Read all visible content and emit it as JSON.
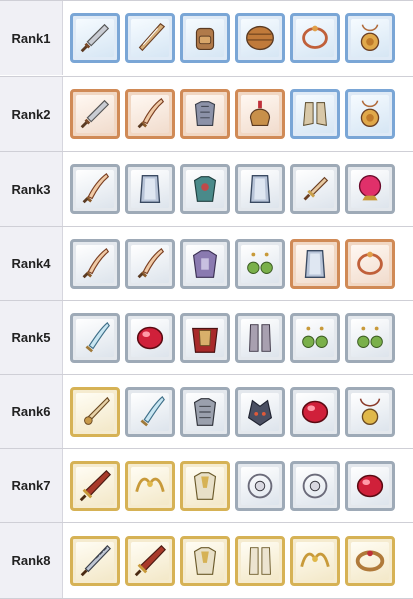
{
  "rows": [
    {
      "label": "Rank1",
      "items": [
        {
          "icon": "sword-icon",
          "frame": "blue"
        },
        {
          "icon": "blade-icon",
          "frame": "blue"
        },
        {
          "icon": "backpack-icon",
          "frame": "blue"
        },
        {
          "icon": "wooden-shield-icon",
          "frame": "blue"
        },
        {
          "icon": "bracelet-icon",
          "frame": "blue"
        },
        {
          "icon": "amulet-icon",
          "frame": "blue"
        }
      ]
    },
    {
      "label": "Rank2",
      "items": [
        {
          "icon": "sword-icon",
          "frame": "bronze"
        },
        {
          "icon": "scimitar-icon",
          "frame": "bronze"
        },
        {
          "icon": "chestplate-icon",
          "frame": "bronze"
        },
        {
          "icon": "helmet-icon",
          "frame": "bronze"
        },
        {
          "icon": "boots-icon",
          "frame": "blue"
        },
        {
          "icon": "amulet-icon",
          "frame": "blue"
        }
      ]
    },
    {
      "label": "Rank3",
      "items": [
        {
          "icon": "scimitar-icon",
          "frame": "silver"
        },
        {
          "icon": "tower-shield-icon",
          "frame": "silver"
        },
        {
          "icon": "armor-icon",
          "frame": "silver"
        },
        {
          "icon": "tower-shield-icon",
          "frame": "silver"
        },
        {
          "icon": "dagger-icon",
          "frame": "silver"
        },
        {
          "icon": "crystal-orb-icon",
          "frame": "silver"
        }
      ]
    },
    {
      "label": "Rank4",
      "items": [
        {
          "icon": "scimitar-icon",
          "frame": "silver"
        },
        {
          "icon": "scimitar-icon",
          "frame": "silver"
        },
        {
          "icon": "heavy-armor-icon",
          "frame": "silver"
        },
        {
          "icon": "earrings-icon",
          "frame": "silver"
        },
        {
          "icon": "tower-shield-icon",
          "frame": "bronze"
        },
        {
          "icon": "bracelet-icon",
          "frame": "bronze"
        }
      ]
    },
    {
      "label": "Rank5",
      "items": [
        {
          "icon": "feather-sword-icon",
          "frame": "silver"
        },
        {
          "icon": "ruby-icon",
          "frame": "silver"
        },
        {
          "icon": "cape-armor-icon",
          "frame": "silver"
        },
        {
          "icon": "greaves-icon",
          "frame": "silver"
        },
        {
          "icon": "earrings-icon",
          "frame": "silver"
        },
        {
          "icon": "earrings-icon",
          "frame": "silver"
        }
      ]
    },
    {
      "label": "Rank6",
      "items": [
        {
          "icon": "dragon-sword-icon",
          "frame": "gold"
        },
        {
          "icon": "feather-sword-icon",
          "frame": "silver"
        },
        {
          "icon": "plate-armor-icon",
          "frame": "silver"
        },
        {
          "icon": "wolf-helmet-icon",
          "frame": "silver"
        },
        {
          "icon": "ruby-icon",
          "frame": "silver"
        },
        {
          "icon": "medallion-icon",
          "frame": "silver"
        }
      ]
    },
    {
      "label": "Rank7",
      "items": [
        {
          "icon": "greatsword-icon",
          "frame": "gold"
        },
        {
          "icon": "tiara-icon",
          "frame": "gold"
        },
        {
          "icon": "gold-armor-icon",
          "frame": "gold"
        },
        {
          "icon": "skull-necklace-icon",
          "frame": "silver"
        },
        {
          "icon": "skull-necklace-icon",
          "frame": "silver"
        },
        {
          "icon": "ruby-icon",
          "frame": "silver"
        }
      ]
    },
    {
      "label": "Rank8",
      "items": [
        {
          "icon": "spiked-sword-icon",
          "frame": "gold"
        },
        {
          "icon": "greatsword-icon",
          "frame": "gold"
        },
        {
          "icon": "gold-armor-icon",
          "frame": "gold"
        },
        {
          "icon": "gold-greaves-icon",
          "frame": "gold"
        },
        {
          "icon": "tiara-icon",
          "frame": "gold"
        },
        {
          "icon": "jeweled-bracelet-icon",
          "frame": "gold"
        },
        {
          "icon": "skull-necklace-icon",
          "frame": "silver"
        }
      ]
    }
  ],
  "colors": {
    "rank_bg": "#f0f0f5",
    "frame_blue": "#7aa6d6",
    "frame_bronze": "#d08a56",
    "frame_silver": "#9eaab7",
    "frame_gold": "#d6b255"
  }
}
